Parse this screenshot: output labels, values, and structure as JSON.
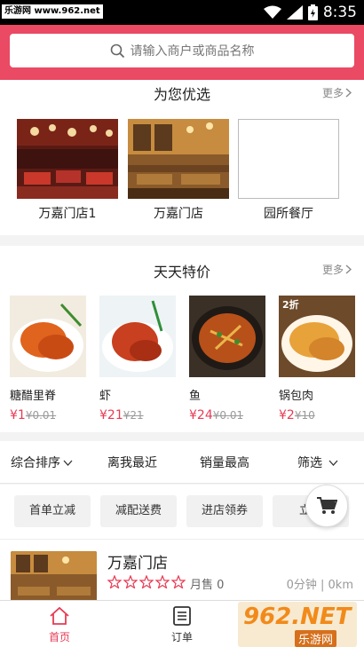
{
  "status_bar": {
    "watermark": "乐游网 www.962.net",
    "time": "8:35"
  },
  "search": {
    "placeholder": "请输入商户或商品名称",
    "icon": "search-icon"
  },
  "recommend": {
    "title": "为您优选",
    "more": "更多",
    "items": [
      {
        "name": "万嘉门店1"
      },
      {
        "name": "万嘉门店"
      },
      {
        "name": "园所餐厅"
      }
    ]
  },
  "deals": {
    "title": "天天特价",
    "more": "更多",
    "items": [
      {
        "name": "糖醋里脊",
        "price": "¥1",
        "old": "¥0.01"
      },
      {
        "name": "虾",
        "price": "¥21",
        "old": "¥21"
      },
      {
        "name": "鱼",
        "price": "¥24",
        "old": "¥0.01"
      },
      {
        "name": "锅包肉",
        "price": "¥2",
        "old": "¥10",
        "badge": "2折"
      }
    ]
  },
  "sort": {
    "items": [
      "综合排序",
      "离我最近",
      "销量最高",
      "筛选"
    ]
  },
  "tags": [
    "首单立减",
    "减配送费",
    "进店领券",
    "立减"
  ],
  "store": {
    "name": "万嘉门店",
    "sales": "月售 0",
    "time": "0分钟",
    "distance": "0km",
    "rating": 0
  },
  "tabbar": {
    "home": "首页",
    "orders": "订单"
  },
  "footer_watermark": {
    "brand": "962.NET",
    "sub": "乐游网"
  },
  "colors": {
    "accent": "#ea4a64",
    "price": "#e63b54"
  }
}
